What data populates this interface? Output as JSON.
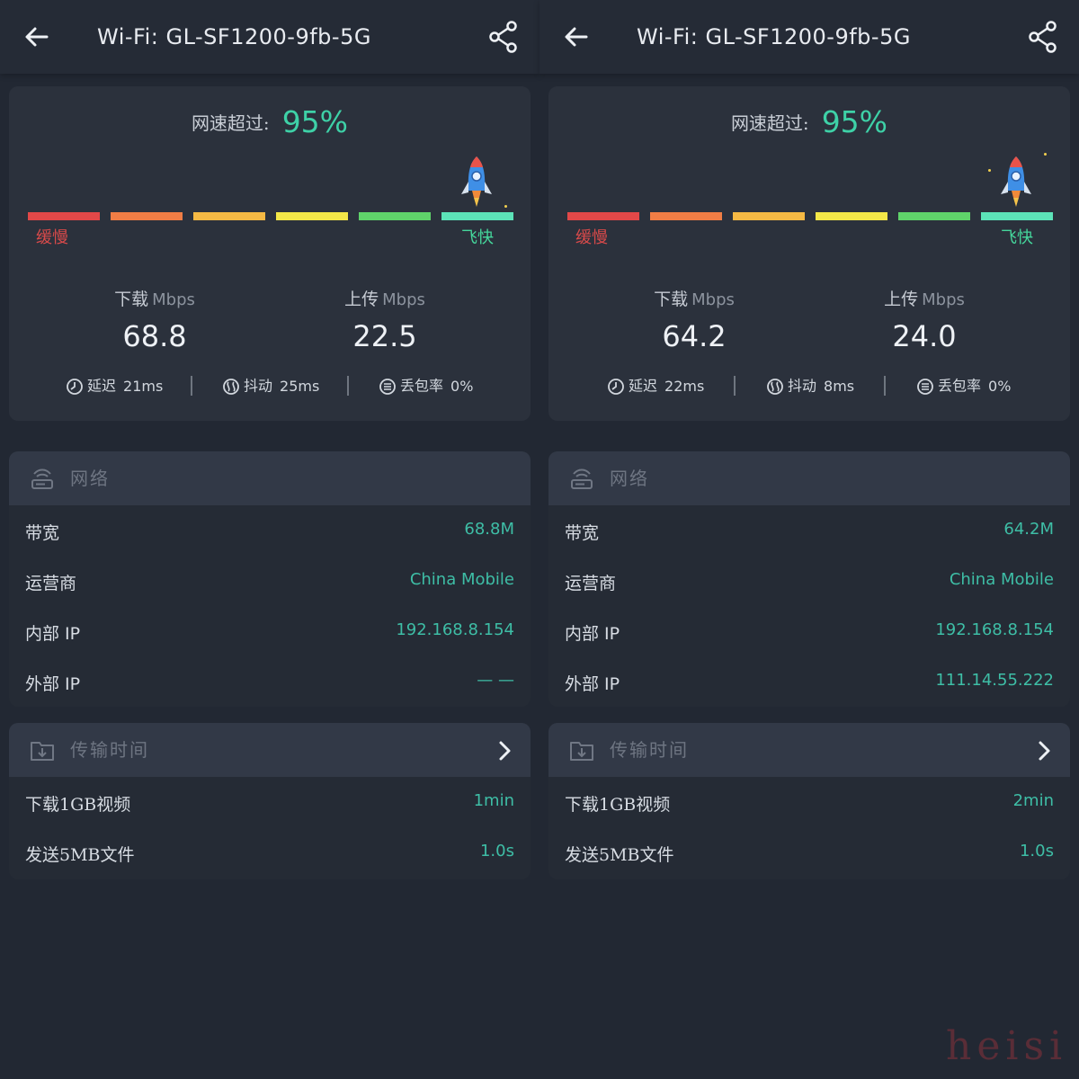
{
  "colors": {
    "background": "#222833",
    "accent_green": "#3ed1a7",
    "value_teal": "#3ebea6",
    "slow_red": "#d94a4a",
    "fast_green": "#45d79c",
    "speed_bar_colors": [
      "#e24848",
      "#f07d45",
      "#f5b944",
      "#f3e748",
      "#5fd36a",
      "#5ce3b8"
    ]
  },
  "icons": {
    "back": "arrow-left-icon",
    "share": "share-icon",
    "rocket": "rocket-icon",
    "latency": "latency-icon",
    "jitter": "jitter-icon",
    "packet_loss": "packet-loss-icon",
    "network": "router-icon",
    "transfer": "folder-download-icon",
    "expand": "chevron-right-icon"
  },
  "panels": [
    {
      "title": "Wi-Fi: GL-SF1200-9fb-5G",
      "exceed_label": "网速超过:",
      "exceed_value": "95%",
      "slow_label": "缓慢",
      "fast_label": "飞快",
      "download": {
        "label": "下载",
        "unit": "Mbps",
        "value": "68.8"
      },
      "upload": {
        "label": "上传",
        "unit": "Mbps",
        "value": "22.5"
      },
      "latency": {
        "label": "延迟",
        "value": "21ms"
      },
      "jitter": {
        "label": "抖动",
        "value": "25ms"
      },
      "packet_loss": {
        "label": "丢包率",
        "value": "0%"
      },
      "network": {
        "title": "网络",
        "bandwidth": {
          "label": "带宽",
          "value": "68.8M"
        },
        "carrier": {
          "label": "运营商",
          "value": "China Mobile"
        },
        "internal_ip": {
          "label": "内部",
          "label_suffix": "IP",
          "value": "192.168.8.154"
        },
        "external_ip": {
          "label": "外部",
          "label_suffix": "IP",
          "value": "— —"
        }
      },
      "transfer": {
        "title": "传输时间",
        "video": {
          "label": "下载1GB视频",
          "value": "1min"
        },
        "file": {
          "label": "发送5MB文件",
          "value": "1.0s"
        }
      }
    },
    {
      "title": "Wi-Fi: GL-SF1200-9fb-5G",
      "exceed_label": "网速超过:",
      "exceed_value": "95%",
      "slow_label": "缓慢",
      "fast_label": "飞快",
      "download": {
        "label": "下载",
        "unit": "Mbps",
        "value": "64.2"
      },
      "upload": {
        "label": "上传",
        "unit": "Mbps",
        "value": "24.0"
      },
      "latency": {
        "label": "延迟",
        "value": "22ms"
      },
      "jitter": {
        "label": "抖动",
        "value": "8ms"
      },
      "packet_loss": {
        "label": "丢包率",
        "value": "0%"
      },
      "network": {
        "title": "网络",
        "bandwidth": {
          "label": "带宽",
          "value": "64.2M"
        },
        "carrier": {
          "label": "运营商",
          "value": "China Mobile"
        },
        "internal_ip": {
          "label": "内部",
          "label_suffix": "IP",
          "value": "192.168.8.154"
        },
        "external_ip": {
          "label": "外部",
          "label_suffix": "IP",
          "value": "111.14.55.222"
        }
      },
      "transfer": {
        "title": "传输时间",
        "video": {
          "label": "下载1GB视频",
          "value": "2min"
        },
        "file": {
          "label": "发送5MB文件",
          "value": "1.0s"
        }
      }
    }
  ],
  "watermark": "heisi"
}
